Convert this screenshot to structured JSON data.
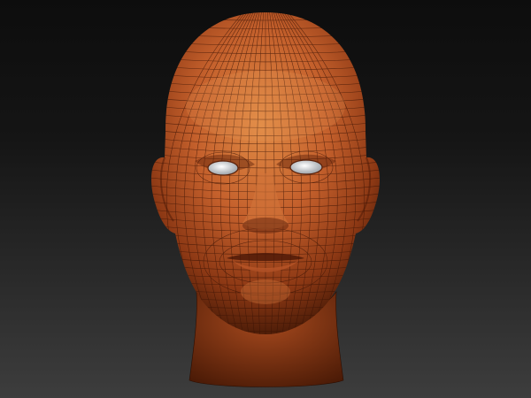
{
  "viewport": {
    "background_top": "#0d0d0d",
    "background_bottom": "#3d3d3d"
  },
  "model": {
    "skin_color": "#c4602c",
    "skin_highlight": "#e0843f",
    "skin_shadow": "#6a2a10",
    "wireframe_color": "#3a1406",
    "eye_color": "#e6e8ea",
    "wireframe_visible": true
  }
}
